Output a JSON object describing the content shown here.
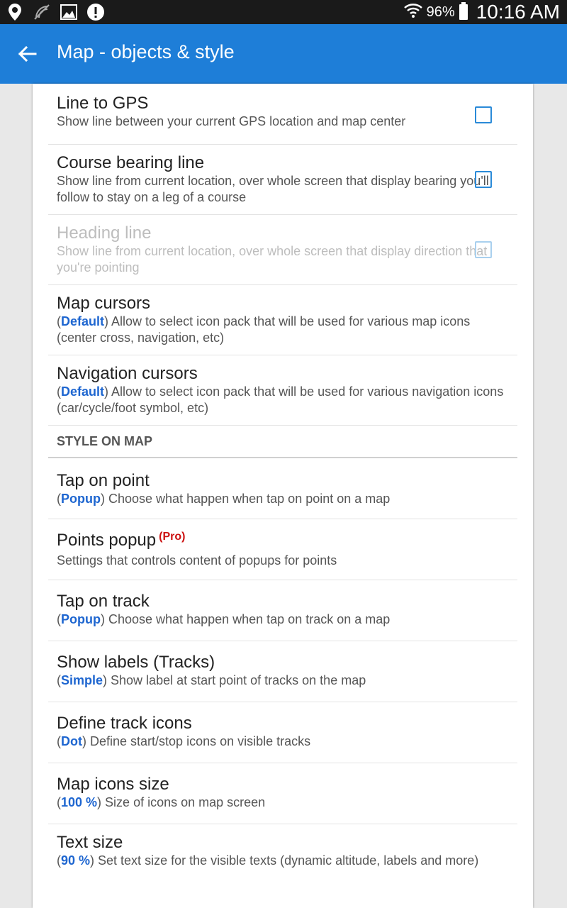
{
  "status_bar": {
    "battery_percent": "96%",
    "time": "10:16 AM"
  },
  "header": {
    "title": "Map - objects & style"
  },
  "items_top": [
    {
      "title": "Line to GPS",
      "desc": "Show line between your current GPS location and map center",
      "checkbox": true,
      "checked": false,
      "disabled": false
    },
    {
      "title": "Course bearing line",
      "desc": "Show line from current location, over whole screen that display bearing you'll follow to stay on a leg of a course",
      "checkbox": true,
      "checked": false,
      "disabled": false
    },
    {
      "title": "Heading line",
      "desc": "Show line from current location, over whole screen that display direction that you're pointing",
      "checkbox": true,
      "checked": false,
      "disabled": true
    },
    {
      "title": "Map cursors",
      "value": "Default",
      "desc": "Allow to select icon pack that will be used for various map icons (center cross, navigation, etc)"
    },
    {
      "title": "Navigation cursors",
      "value": "Default",
      "desc": "Allow to select icon pack that will be used for various navigation icons (car/cycle/foot symbol, etc)"
    }
  ],
  "section_style": "STYLE ON MAP",
  "items_style": [
    {
      "title": "Tap on point",
      "value": "Popup",
      "desc": "Choose what happen when tap on point on a map"
    },
    {
      "title": "Points popup",
      "badge": "(Pro)",
      "desc": "Settings that controls content of popups for points"
    },
    {
      "title": "Tap on track",
      "value": "Popup",
      "desc": "Choose what happen when tap on track on a map"
    },
    {
      "title": "Show labels (Tracks)",
      "value": "Simple",
      "desc": "Show label at start point of tracks on the map"
    },
    {
      "title": "Define track icons",
      "value": "Dot",
      "desc": "Define start/stop icons on visible tracks"
    },
    {
      "title": "Map icons size",
      "value": "100 %",
      "desc": "Size of icons on map screen"
    },
    {
      "title": "Text size",
      "value": "90 %",
      "desc": "Set text size for the visible texts (dynamic altitude, labels and more)"
    }
  ]
}
